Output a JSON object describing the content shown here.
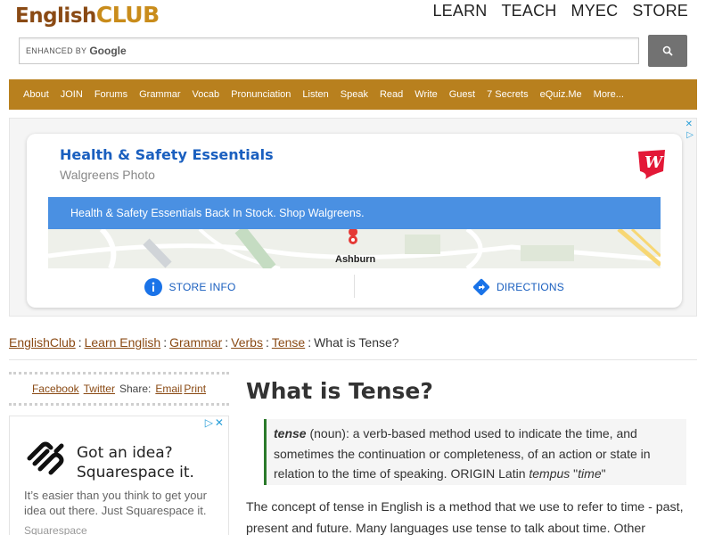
{
  "header": {
    "logo_part1": "English",
    "logo_part2": "CLUB",
    "top_nav": [
      "LEARN",
      "TEACH",
      "MYEC",
      "STORE"
    ]
  },
  "search": {
    "enhanced_label": "enhanced by",
    "google_label": "Google",
    "button_icon": "search-icon"
  },
  "nav": {
    "items": [
      "About",
      "JOIN",
      "Forums",
      "Grammar",
      "Vocab",
      "Pronunciation",
      "Listen",
      "Speak",
      "Read",
      "Write",
      "Guest",
      "7 Secrets",
      "eQuiz.Me",
      "More..."
    ]
  },
  "ad1": {
    "title": "Health & Safety Essentials",
    "subtitle": "Walgreens Photo",
    "banner": "Health & Safety Essentials Back In Stock. Shop Walgreens.",
    "map_label": "Ashburn",
    "store_info": "STORE INFO",
    "directions": "DIRECTIONS",
    "colors": {
      "title": "#1a5fbf",
      "banner": "#4a90e2",
      "walgreens_red": "#e31837"
    }
  },
  "breadcrumb": {
    "links": [
      "EnglishClub",
      "Learn English",
      "Grammar",
      "Verbs",
      "Tense"
    ],
    "current": "What is Tense?"
  },
  "share": {
    "facebook": "Facebook",
    "twitter": "Twitter",
    "share_label": "Share:",
    "email": "Email",
    "print": "Print"
  },
  "ad2": {
    "headline_1": "Got an idea?",
    "headline_2": "Squarespace it.",
    "body": "It’s easier than you think to get your idea out there. Just Squarespace it.",
    "brand": "Squarespace"
  },
  "article": {
    "title": "What is Tense?",
    "definition": {
      "term": "tense",
      "pos": "(noun)",
      "text": ": a verb-based method used to indicate the time, and sometimes the continuation or completeness, of an action or state in relation to the time of speaking. ORIGIN Latin ",
      "origin_word": "tempus",
      "origin_gloss": "time"
    },
    "paragraph": "The concept of tense in English is a method that we use to refer to time - past, present and future. Many languages use tense to talk about time. Other"
  },
  "colors": {
    "brand_brown": "#8a4a14",
    "brand_gold": "#c98c1b",
    "nav_bg": "#b8801e",
    "definition_border": "#2b7a2b"
  }
}
